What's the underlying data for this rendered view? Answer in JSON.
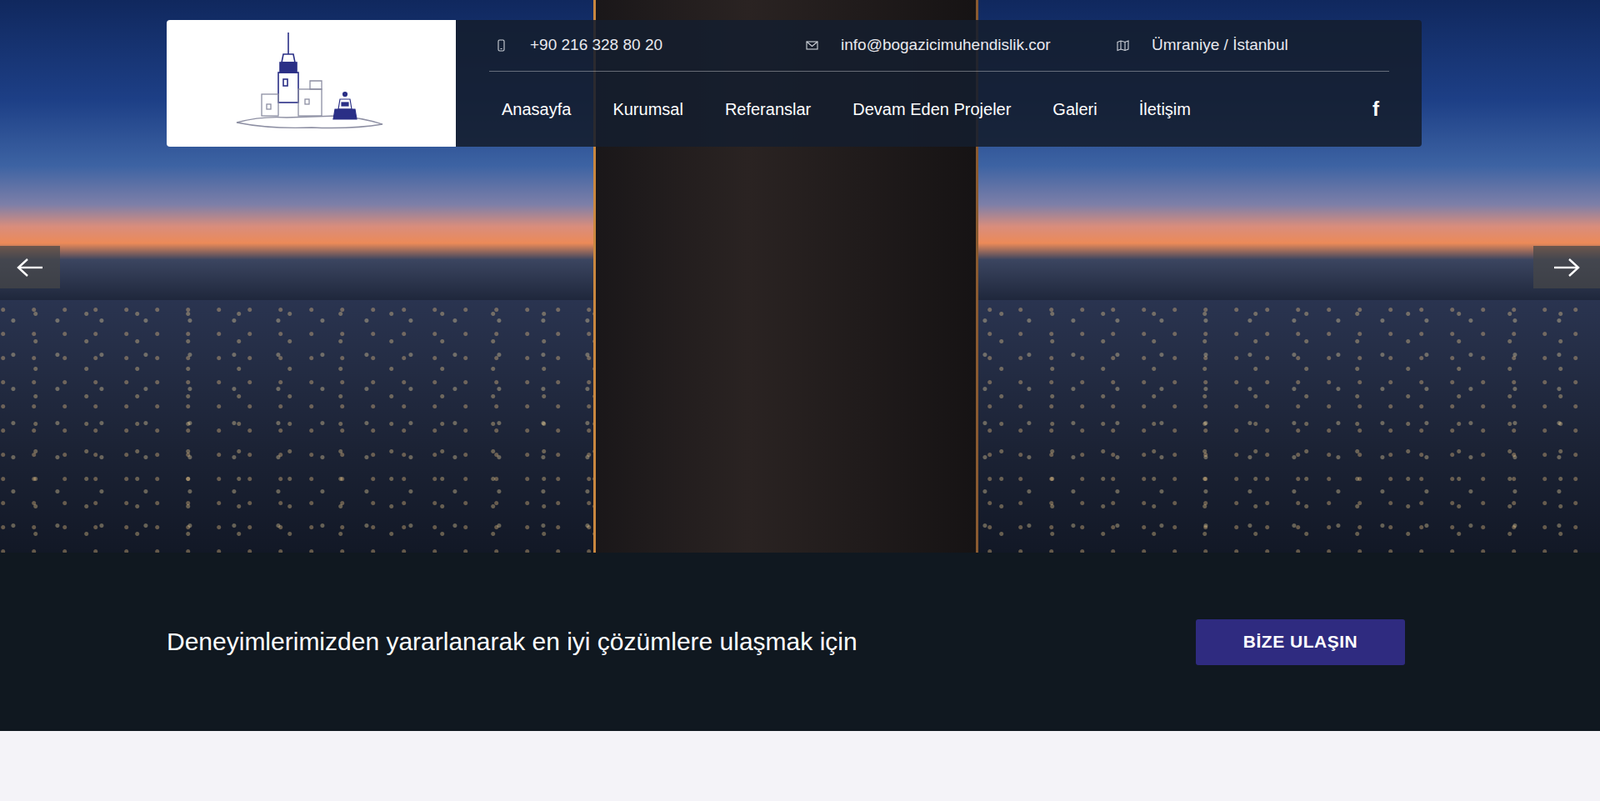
{
  "contacts": [
    {
      "text": "+90 216 328 80 20",
      "kind": "phone"
    },
    {
      "text": "info@bogazicimuhendislik.cor",
      "kind": "email"
    },
    {
      "text": "Ümraniye / İstanbul",
      "kind": "address"
    }
  ],
  "nav": [
    {
      "label": "Anasayfa",
      "selected": false
    },
    {
      "label": "Kurumsal",
      "selected": false
    },
    {
      "label": "Referanslar",
      "selected": false
    },
    {
      "label": "Devam Eden Projeler",
      "selected": false
    },
    {
      "label": "Galeri",
      "selected": false
    },
    {
      "label": "İletişim",
      "selected": false
    }
  ],
  "social": [
    {
      "label": "f"
    }
  ],
  "cta": {
    "text": "Deneyimlerimizden yararlanarak en iyi çözümlere ulaşmak için",
    "button": "BİZE ULAŞIN"
  }
}
